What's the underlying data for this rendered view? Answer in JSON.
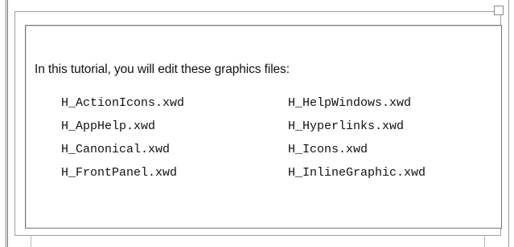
{
  "intro_text": "In this tutorial, you will edit these graphics files:",
  "files": [
    "H_ActionIcons.xwd",
    "H_HelpWindows.xwd",
    "H_AppHelp.xwd",
    "H_Hyperlinks.xwd",
    "H_Canonical.xwd",
    "H_Icons.xwd",
    "H_FrontPanel.xwd",
    "H_InlineGraphic.xwd"
  ]
}
